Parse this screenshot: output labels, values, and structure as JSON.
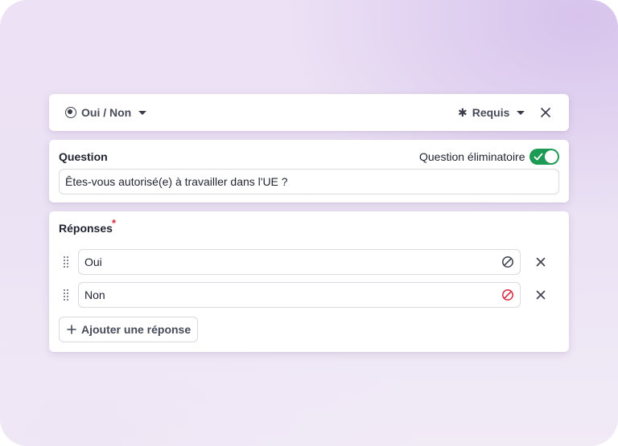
{
  "topbar": {
    "type_label": "Oui / Non",
    "required_label": "Requis",
    "icons": {
      "type": "radio-icon",
      "required": "asterisk-icon",
      "close": "close-icon"
    }
  },
  "question": {
    "label": "Question",
    "eliminatory_label": "Question éliminatoire",
    "eliminatory_enabled": true,
    "value": "Êtes-vous autorisé(e) à travailler dans l'UE ?"
  },
  "answers": {
    "label": "Réponses",
    "required_marker": "*",
    "items": [
      {
        "value": "Oui",
        "disqualifying": false
      },
      {
        "value": "Non",
        "disqualifying": true
      }
    ],
    "add_label": "Ajouter une réponse"
  },
  "colors": {
    "toggle_on": "#1d9b55",
    "disqualify_active": "#d6263a",
    "disqualify_inactive": "#3b3f4c",
    "required_star": "#d6263a"
  }
}
